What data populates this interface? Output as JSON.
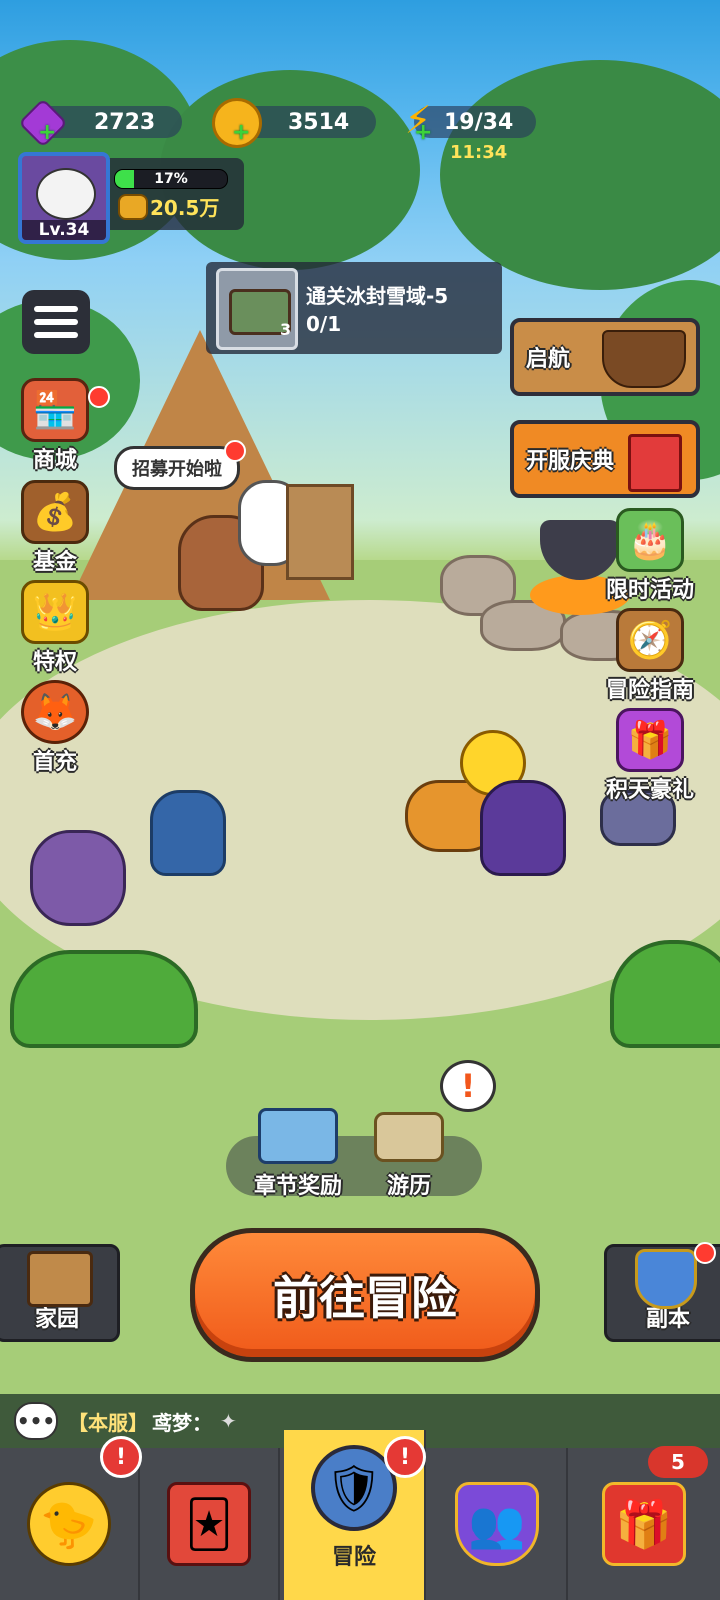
{
  "resources": {
    "gems": "2723",
    "coins": "3514",
    "energy": "19/34",
    "energy_timer": "11:34"
  },
  "player": {
    "level": "Lv.34",
    "exp_percent": "17%",
    "exp_fraction": 0.17,
    "power": "20.5万"
  },
  "quest": {
    "title": "通关冰封雪域-5",
    "progress": "0/1",
    "reward_count": "3"
  },
  "left_menu": [
    {
      "label": "商城"
    },
    {
      "label": "基金"
    },
    {
      "label": "特权"
    },
    {
      "label": "首充"
    }
  ],
  "right_menu": {
    "set_sail": "启航",
    "server_celebration": "开服庆典",
    "limited_event": "限时活动",
    "adventure_guide": "冒险指南",
    "rewards_gift": "积天豪礼"
  },
  "speech_bubble": "招募开始啦",
  "actions": {
    "chapter_rewards": "章节奖励",
    "journey": "游历",
    "go_adventure": "前往冒险",
    "home": "家园",
    "dungeon": "副本"
  },
  "chat": {
    "channel": "【本服】",
    "user": "鸢梦："
  },
  "bottom_nav": {
    "active_label": "冒险",
    "badge_count": "5"
  },
  "colors": {
    "active_tab": "#ffd84a",
    "adventure_button": "#f4661f",
    "alert": "#e53935"
  }
}
